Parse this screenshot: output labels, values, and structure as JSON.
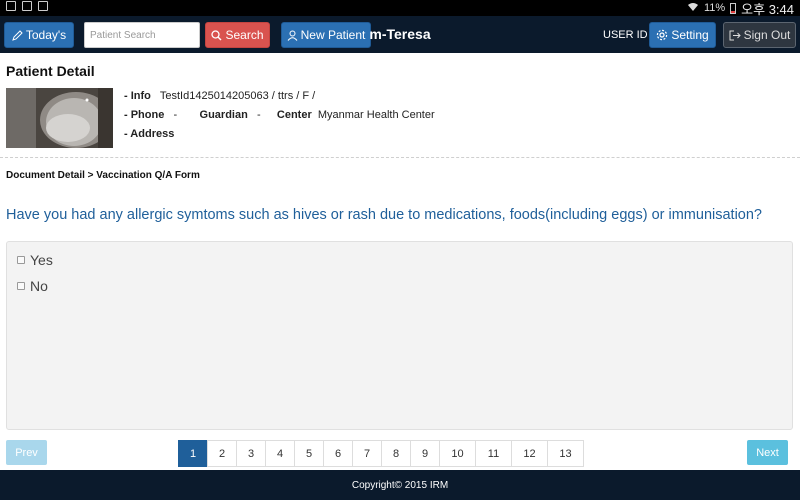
{
  "status_bar": {
    "battery": "11%",
    "time": "오후 3:44"
  },
  "navbar": {
    "today_label": "Today's",
    "search_placeholder": "Patient Search",
    "search_label": "Search",
    "new_patient_label": "New Patient",
    "app_title": "m-Teresa",
    "user_id": "USER ID",
    "setting_label": "Setting",
    "signout_label": "Sign Out"
  },
  "patient": {
    "section_title": "Patient Detail",
    "info_label": "- Info",
    "info_value": "TestId1425014205063 / ttrs / F /",
    "phone_label": "- Phone",
    "phone_value": "-",
    "guardian_label": "Guardian",
    "guardian_value": "-",
    "center_label": "Center",
    "center_value": "Myanmar Health Center",
    "address_label": "- Address"
  },
  "breadcrumb": "Document Detail > Vaccination Q/A Form",
  "question": "Have you had any allergic symtoms such as hives or rash due to medications, foods(including eggs) or immunisation?",
  "answers": [
    {
      "label": "Yes",
      "checked": false
    },
    {
      "label": "No",
      "checked": false
    }
  ],
  "pagination": {
    "prev_label": "Prev",
    "next_label": "Next",
    "pages": [
      "1",
      "2",
      "3",
      "4",
      "5",
      "6",
      "7",
      "8",
      "9",
      "10",
      "11",
      "12",
      "13"
    ],
    "active_page": "1"
  },
  "footer": "Copyright© 2015 IRM",
  "colors": {
    "navbar": "#0b1a2c",
    "primary": "#2b70b3",
    "danger": "#d9534f",
    "question_text": "#1f5f9a",
    "info": "#5bc0de"
  }
}
